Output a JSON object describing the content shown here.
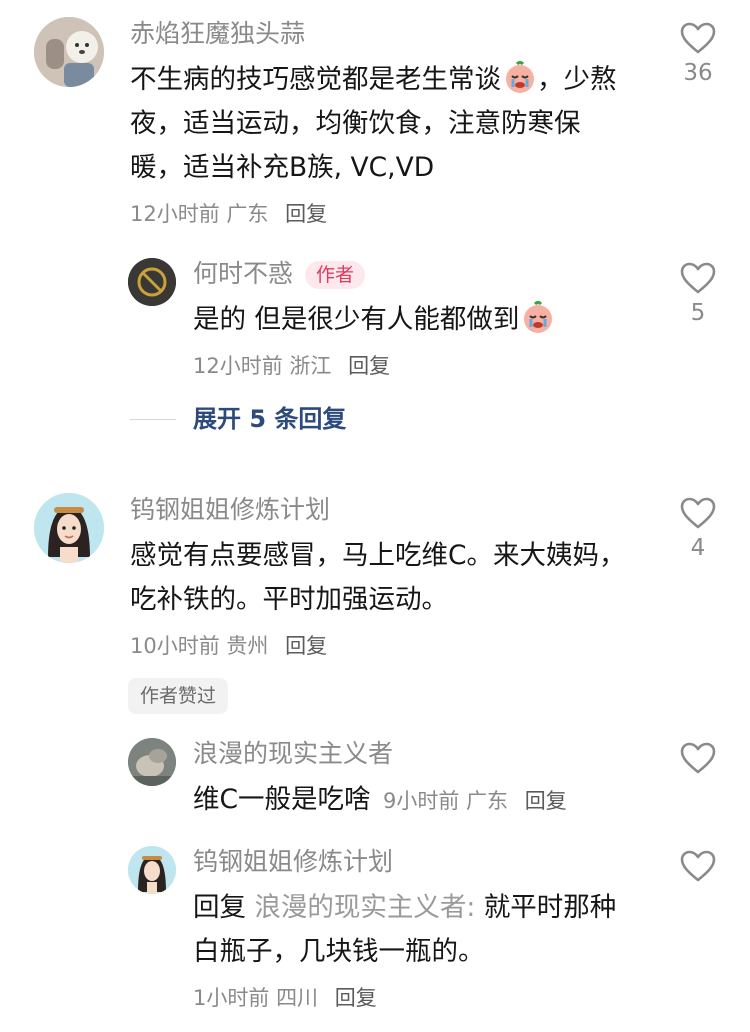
{
  "comments": [
    {
      "author": "赤焰狂魔独头蒜",
      "text": "不生病的技巧感觉都是老生常谈",
      "text_after_emoji": "，少熬夜，适当运动，均衡饮食，注意防寒保暖，适当补充B族, VC,VD",
      "time": "12小时前",
      "region": "广东",
      "reply_label": "回复",
      "likes": "36",
      "replies": [
        {
          "author": "何时不惑",
          "badge": "作者",
          "text": "是的 但是很少有人能都做到",
          "time": "12小时前",
          "region": "浙江",
          "reply_label": "回复",
          "likes": "5"
        }
      ],
      "expand_label": "展开 5 条回复"
    },
    {
      "author": "钨钢姐姐修炼计划",
      "text": "感觉有点要感冒，马上吃维C。来大姨妈，吃补铁的。平时加强运动。",
      "time": "10小时前",
      "region": "贵州",
      "reply_label": "回复",
      "likes": "4",
      "author_liked_badge": "作者赞过",
      "replies": [
        {
          "author": "浪漫的现实主义者",
          "text": "维C一般是吃啥",
          "time": "9小时前",
          "region": "广东",
          "reply_label": "回复"
        },
        {
          "author": "钨钢姐姐修炼计划",
          "reply_prefix": "回复",
          "reply_to": "浪漫的现实主义者:",
          "text": "就平时那种白瓶子，几块钱一瓶的。",
          "time": "1小时前",
          "region": "四川",
          "reply_label": "回复"
        }
      ]
    }
  ],
  "colors": {
    "author_badge_bg": "#fde8ee",
    "author_badge_text": "#e23b5e",
    "expand_link": "#2d4a7c"
  },
  "icons": {
    "like": "heart-outline-icon",
    "emoji": "crying-face-emoji"
  }
}
